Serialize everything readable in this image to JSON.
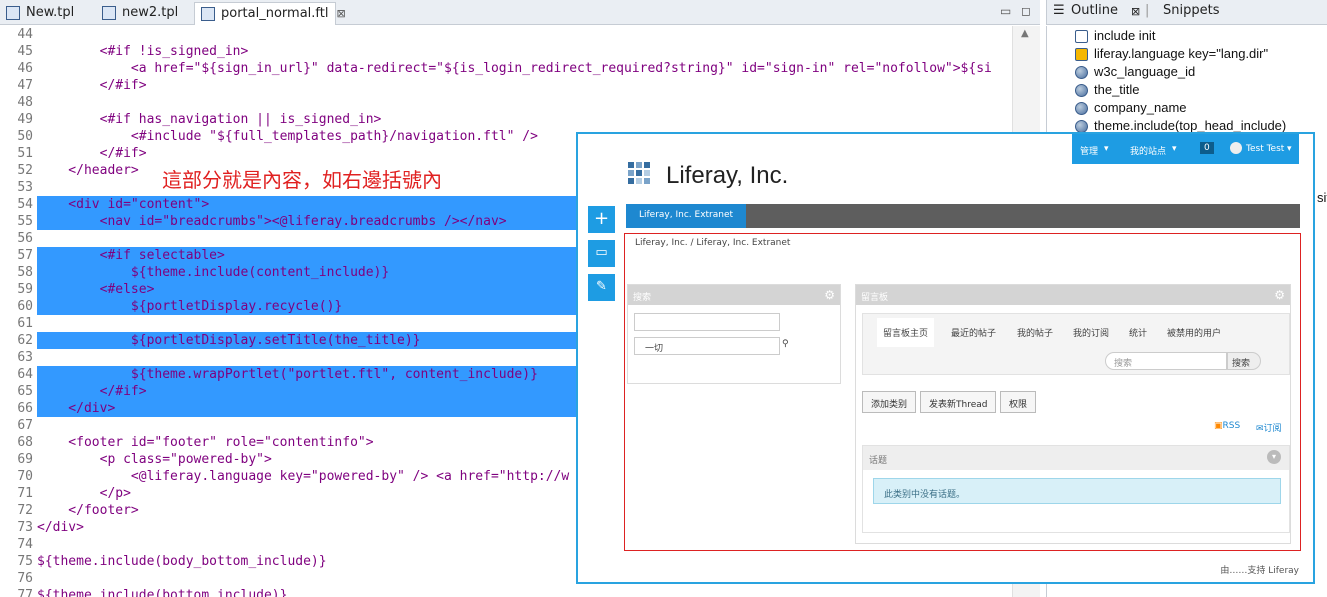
{
  "tabs": [
    {
      "label": "New.tpl"
    },
    {
      "label": "new2.tpl"
    },
    {
      "label": "portal_normal.ftl",
      "close": "⊠"
    }
  ],
  "window_controls": {
    "minimize": "▭",
    "maximize": "◻"
  },
  "code_lines": [
    {
      "num": "44",
      "text": ""
    },
    {
      "num": "45",
      "text": "        <#if !is_signed_in>"
    },
    {
      "num": "46",
      "text": "            <a href=\"${sign_in_url}\" data-redirect=\"${is_login_redirect_required?string}\" id=\"sign-in\" rel=\"nofollow\">${si"
    },
    {
      "num": "47",
      "text": "        </#if>"
    },
    {
      "num": "48",
      "text": ""
    },
    {
      "num": "49",
      "text": "        <#if has_navigation || is_signed_in>"
    },
    {
      "num": "50",
      "text": "            <#include \"${full_templates_path}/navigation.ftl\" />"
    },
    {
      "num": "51",
      "text": "        </#if>"
    },
    {
      "num": "52",
      "text": "    </header>"
    },
    {
      "num": "53",
      "text": ""
    },
    {
      "num": "54",
      "text": "    <div id=\"content\">",
      "hl": true
    },
    {
      "num": "55",
      "text": "        <nav id=\"breadcrumbs\"><@liferay.breadcrumbs /></nav>",
      "hl": true
    },
    {
      "num": "56",
      "text": "",
      "hl": true
    },
    {
      "num": "57",
      "text": "        <#if selectable>",
      "hl": true
    },
    {
      "num": "58",
      "text": "            ${theme.include(content_include)}",
      "hl": true
    },
    {
      "num": "59",
      "text": "        <#else>",
      "hl": true
    },
    {
      "num": "60",
      "text": "            ${portletDisplay.recycle()}",
      "hl": true
    },
    {
      "num": "61",
      "text": "",
      "hl": true
    },
    {
      "num": "62",
      "text": "            ${portletDisplay.setTitle(the_title)}",
      "hl": true
    },
    {
      "num": "63",
      "text": "",
      "hl": true
    },
    {
      "num": "64",
      "text": "            ${theme.wrapPortlet(\"portlet.ftl\", content_include)}",
      "hl": true
    },
    {
      "num": "65",
      "text": "        </#if>",
      "hl": true
    },
    {
      "num": "66",
      "text": "    </div>",
      "hl": true
    },
    {
      "num": "67",
      "text": ""
    },
    {
      "num": "68",
      "text": "    <footer id=\"footer\" role=\"contentinfo\">"
    },
    {
      "num": "69",
      "text": "        <p class=\"powered-by\">"
    },
    {
      "num": "70",
      "text": "            <@liferay.language key=\"powered-by\" /> <a href=\"http://w"
    },
    {
      "num": "71",
      "text": "        </p>"
    },
    {
      "num": "72",
      "text": "    </footer>"
    },
    {
      "num": "73",
      "text": "</div>"
    },
    {
      "num": "74",
      "text": ""
    },
    {
      "num": "75",
      "text": "${theme.include(body_bottom_include)}"
    },
    {
      "num": "76",
      "text": ""
    },
    {
      "num": "77",
      "text": "${theme.include(bottom_include)}"
    }
  ],
  "annotation": "這部分就是內容，如右邊括號內",
  "outline_panel": {
    "tab_outline": "Outline",
    "tab_snippets": "Snippets",
    "items": [
      "include init",
      "liferay.language key=\"lang.dir\"",
      "w3c_language_id",
      "the_title",
      "company_name",
      "theme.include(top_head_include)"
    ],
    "cut_text": "sit"
  },
  "preview": {
    "dock": {
      "manage": "管理",
      "my_sites": "我的站点",
      "count": "0",
      "user": "Test Test"
    },
    "brand": "Liferay, Inc.",
    "nav_item": "Liferay, Inc. Extranet",
    "breadcrumb": "Liferay, Inc. / Liferay, Inc. Extranet",
    "search_portlet": {
      "title": "搜索",
      "select": "一切"
    },
    "mb_portlet": {
      "title": "留言板",
      "tabs": [
        "留言板主页",
        "最近的帖子",
        "我的帖子",
        "我的订阅",
        "统计",
        "被禁用的用户"
      ],
      "search_placeholder": "搜索",
      "search_button": "搜索",
      "buttons": [
        "添加类别",
        "发表新Thread",
        "权限"
      ],
      "rss": "RSS",
      "subscribe": "订阅",
      "threads": "话题",
      "empty": "此类别中没有话题。"
    },
    "footer": "由……支持 Liferay"
  },
  "colors": {
    "highlight": "#3399ff",
    "preview_border": "#29a3e0",
    "content_border": "#dd2222",
    "accent": "#1e9ce3"
  }
}
